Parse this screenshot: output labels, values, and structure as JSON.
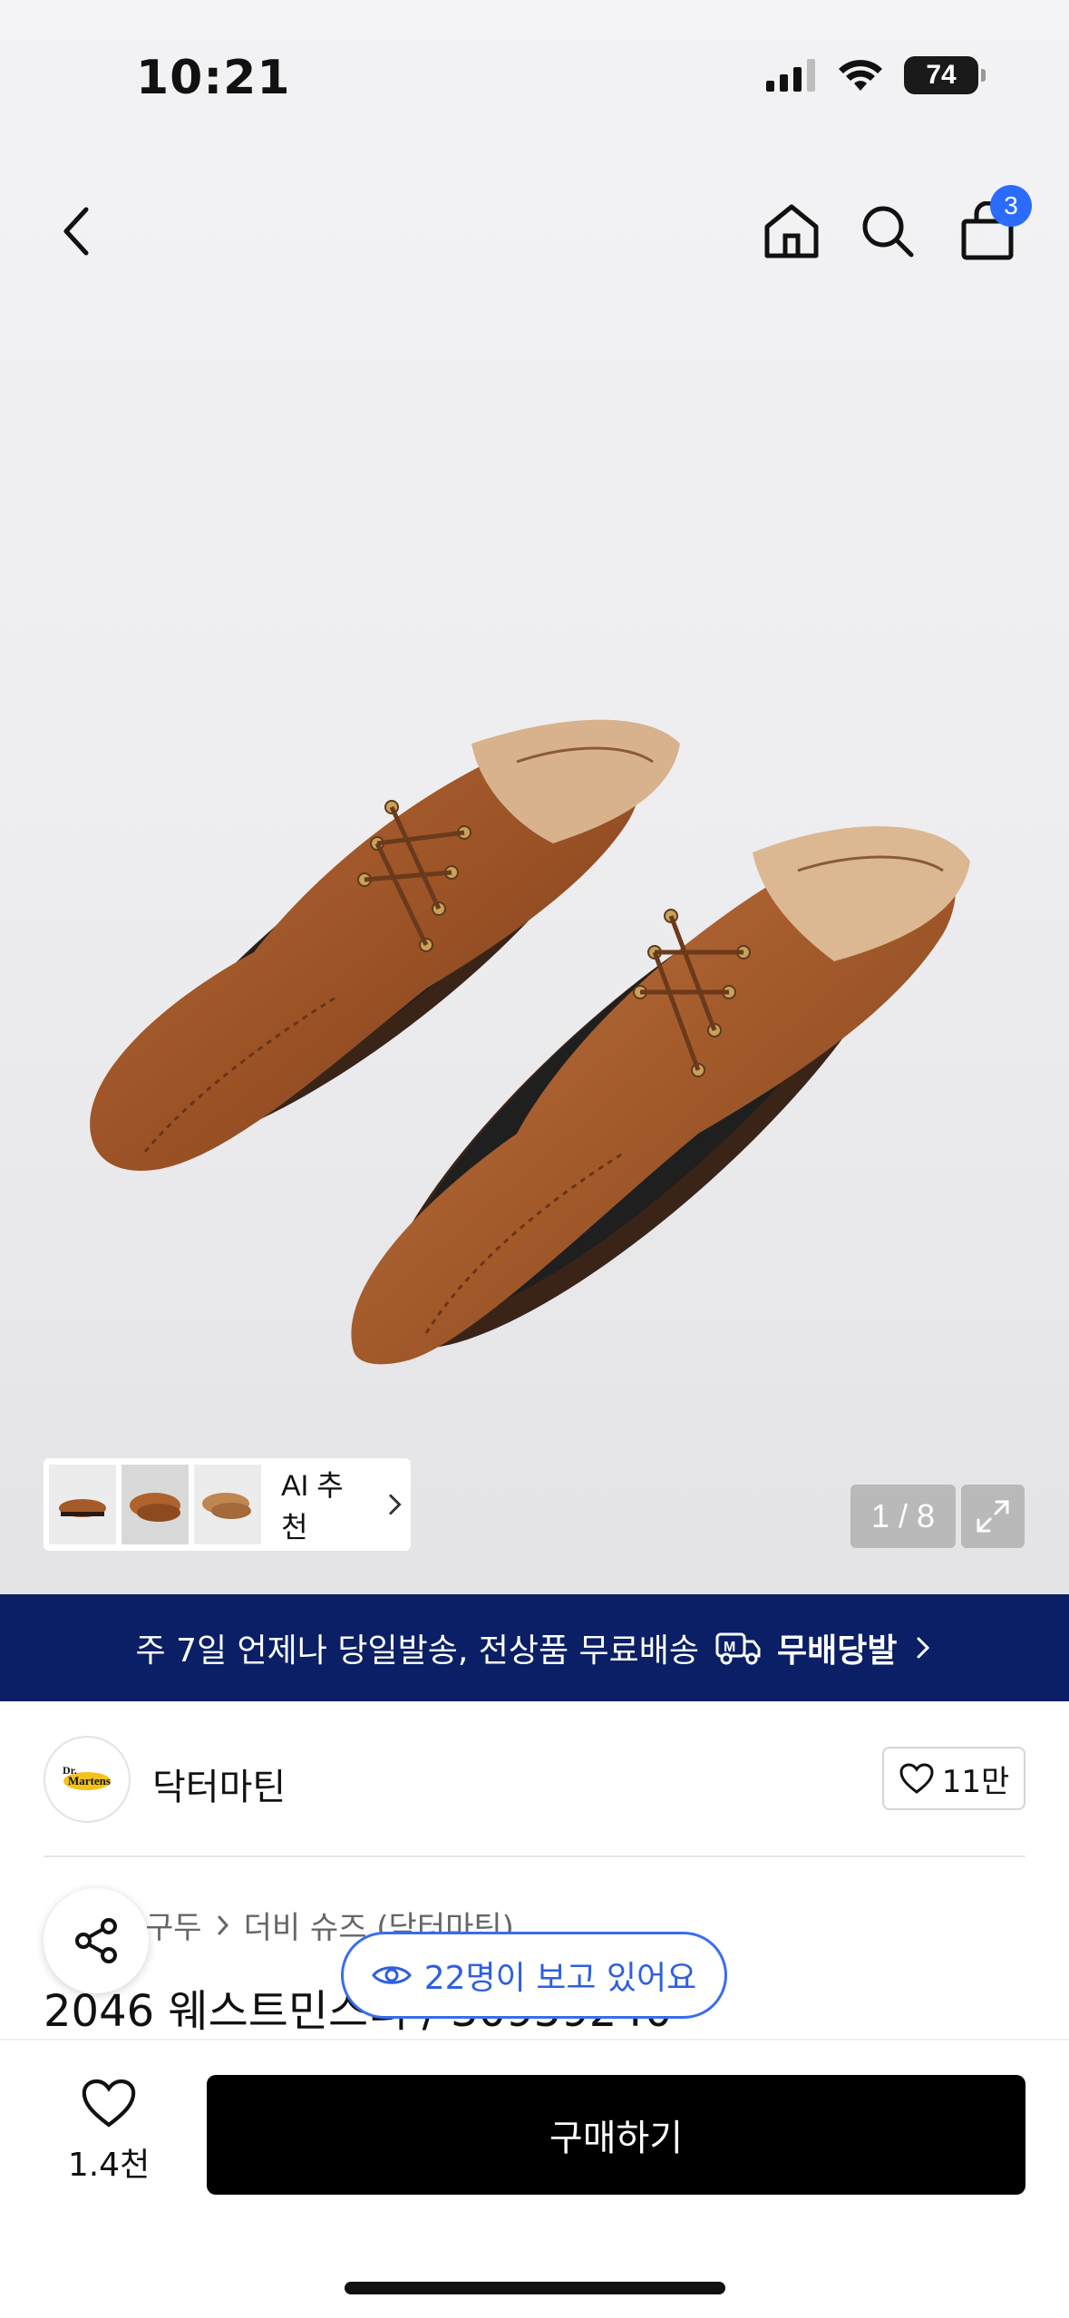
{
  "status_bar": {
    "time": "10:21",
    "battery": "74"
  },
  "nav": {
    "back_icon": "chevron-left-icon",
    "home_icon": "home-icon",
    "search_icon": "search-icon",
    "cart_icon": "shopping-bag-icon",
    "cart_count": "3"
  },
  "gallery": {
    "ai_label": "AI 추천",
    "page_counter": "1 / 8",
    "thumbnails": [
      "thumb-1",
      "thumb-2",
      "thumb-3"
    ]
  },
  "shipping_banner": {
    "text": "주 7일 언제나 당일발송, 전상품 무료배송",
    "brand": "무배당발"
  },
  "brand": {
    "name": "닥터마틴",
    "likes": "11만"
  },
  "breadcrumb": [
    "구두",
    "더비 슈즈 (닥터마틴)"
  ],
  "product": {
    "title": "2046 웨스트민스터 / 30959240"
  },
  "viewers": {
    "text": "22명이 보고 있어요"
  },
  "bottom_bar": {
    "wish_count": "1.4천",
    "buy_label": "구매하기"
  },
  "colors": {
    "banner_bg": "#0a1f66",
    "accent_blue": "#2f5fe0",
    "badge_blue": "#2b6cff",
    "buy_button": "#000000"
  }
}
